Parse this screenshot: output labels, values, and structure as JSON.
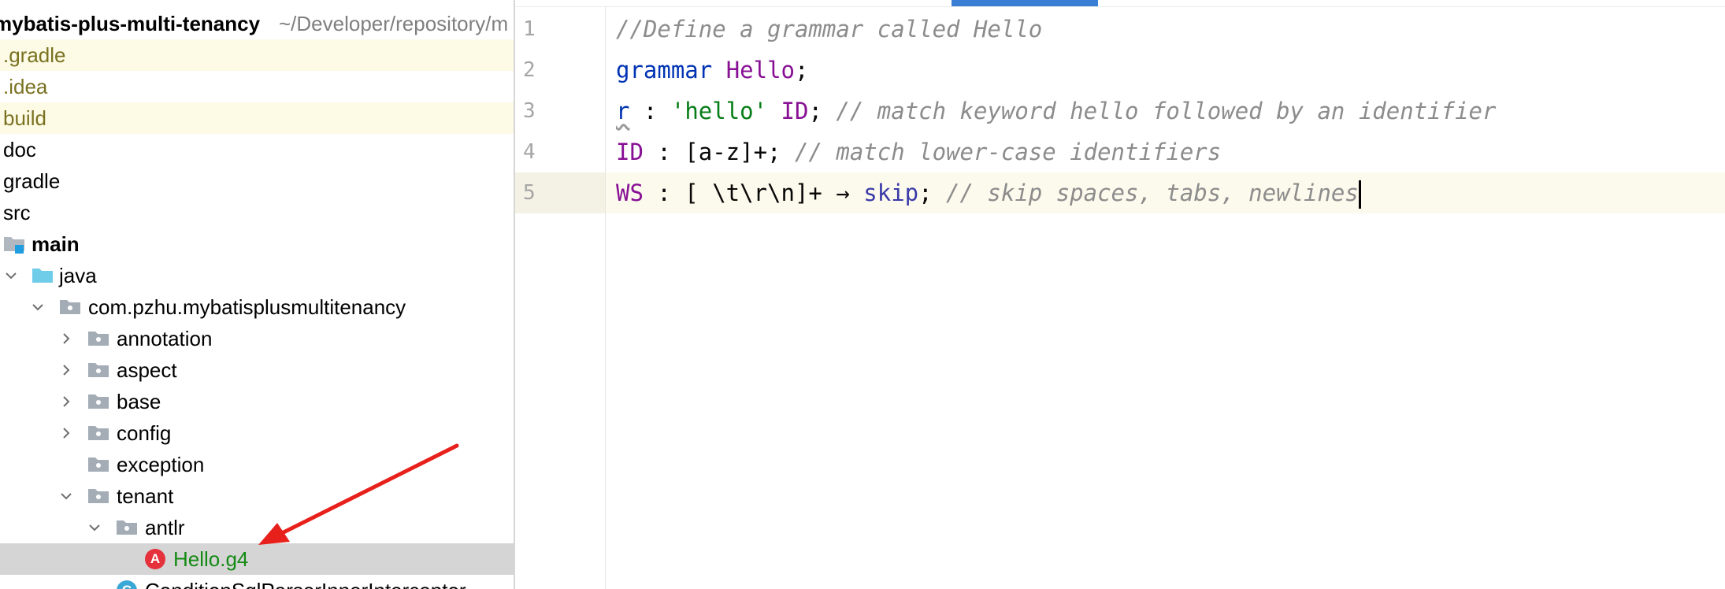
{
  "project": {
    "name": "mybatis-plus-multi-tenancy",
    "path": "~/Developer/repository/m"
  },
  "tree": {
    "items": [
      {
        "label": ".gradle"
      },
      {
        "label": ".idea"
      },
      {
        "label": "build"
      },
      {
        "label": "doc"
      },
      {
        "label": "gradle"
      },
      {
        "label": "src"
      },
      {
        "label": "main"
      },
      {
        "label": "java"
      },
      {
        "label": "com.pzhu.mybatisplusmultitenancy"
      },
      {
        "label": "annotation"
      },
      {
        "label": "aspect"
      },
      {
        "label": "base"
      },
      {
        "label": "config"
      },
      {
        "label": "exception"
      },
      {
        "label": "tenant"
      },
      {
        "label": "antlr"
      },
      {
        "label": "Hello.g4",
        "badge": "A"
      },
      {
        "label": "ConditionSqlParserInnerInterceptor",
        "badge": "C"
      }
    ]
  },
  "editor": {
    "line_numbers": [
      "1",
      "2",
      "3",
      "4",
      "5"
    ],
    "lines": {
      "l1": {
        "comment": "//Define a grammar called Hello"
      },
      "l2": {
        "kw": "grammar",
        "name": "Hello",
        "semi": ";"
      },
      "l3": {
        "rule": "r",
        "colon": " : ",
        "str": "'hello'",
        "id": "ID",
        "semi": "; ",
        "comment": "// match keyword hello followed by an identifier"
      },
      "l4": {
        "id": "ID",
        "body": " : [a-z]+; ",
        "comment": "// match lower-case identifiers"
      },
      "l5": {
        "id": "WS",
        "body": " : [ \\t\\r\\n]+ → ",
        "skip": "skip",
        "semi": "; ",
        "comment": "// skip spaces, tabs, newlines"
      }
    }
  },
  "colors": {
    "comment": "#8c8c8c",
    "keyword": "#0033b3",
    "token": "#871094",
    "string": "#067d17",
    "ignored_highlight": "#fdfbe6",
    "selection": "#d5d5d5",
    "arrow": "#e8201c",
    "tab_indicator": "#3b7ed6"
  }
}
